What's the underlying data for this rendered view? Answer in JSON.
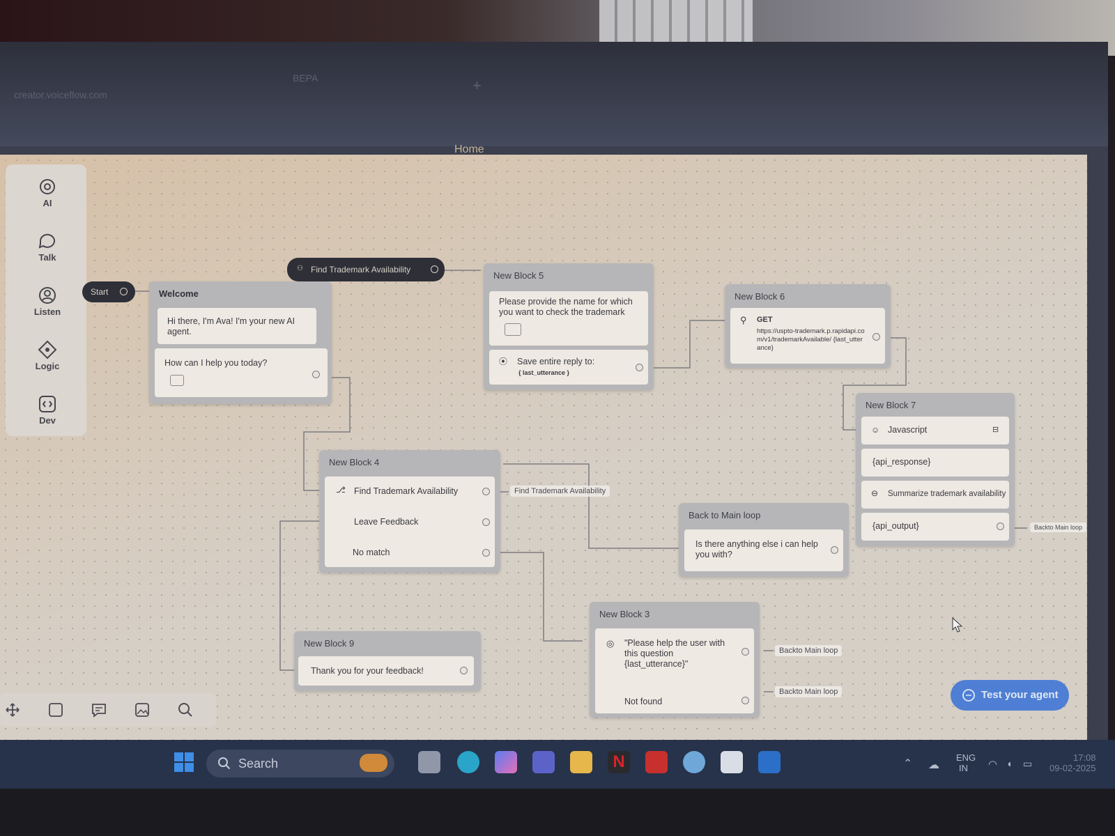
{
  "browser": {
    "url_text": "creator.voiceflow.com",
    "tab_text": "BEPA",
    "new_tab_icon": "plus-icon",
    "page_title": "Home"
  },
  "sidebar": {
    "items": [
      {
        "label": "AI",
        "icon": "openai-icon"
      },
      {
        "label": "Talk",
        "icon": "chat-bubble-icon"
      },
      {
        "label": "Listen",
        "icon": "person-circle-icon"
      },
      {
        "label": "Logic",
        "icon": "diamond-logic-icon"
      },
      {
        "label": "Dev",
        "icon": "code-icon"
      }
    ]
  },
  "start": {
    "label": "Start"
  },
  "trigger": {
    "label": "Find Trademark Availability"
  },
  "welcome": {
    "title": "Welcome",
    "text1": "Hi there, I'm Ava! I'm your new AI agent.",
    "text2": "How can I help you today?"
  },
  "block5": {
    "title": "New Block 5",
    "text": "Please provide the name for which you want to check the trademark",
    "capture_label": "Save entire reply to:",
    "capture_var": "{ last_utterance }"
  },
  "block6": {
    "title": "New Block 6",
    "method": "GET",
    "url": "https://uspto-trademark.p.rapidapi.com/v1/trademarkAvailable/ {last_utterance}"
  },
  "block7": {
    "title": "New Block 7",
    "row1": "Javascript",
    "row2": "{api_response}",
    "row3": "Summarize trademark availability",
    "row4": "{api_output}",
    "tag": "Backto Main loop"
  },
  "block4": {
    "title": "New Block 4",
    "choices": [
      "Find Trademark Availability",
      "Leave Feedback",
      "No match"
    ],
    "tag": "Find Trademark Availability"
  },
  "mainloop": {
    "title": "Back to Main loop",
    "text": "Is there anything else i can help you with?"
  },
  "block3": {
    "title": "New Block 3",
    "prompt": "\"Please help the user with this question {last_utterance}\"",
    "not_found": "Not found",
    "tag1": "Backto Main loop",
    "tag2": "Backto Main loop"
  },
  "block9": {
    "title": "New Block 9",
    "text": "Thank you for your feedback!"
  },
  "toolbar": {
    "icons": [
      "move-icon",
      "note-icon",
      "comment-icon",
      "image-icon",
      "search-icon"
    ]
  },
  "test_button": {
    "label": "Test your agent",
    "icon": "chat-icon"
  },
  "taskbar": {
    "search_label": "Search",
    "lang1": "ENG",
    "lang2": "IN",
    "time": "17:08",
    "date": "09-02-2025"
  },
  "colors": {
    "canvas": "#d6cfc6",
    "node": "#b6b6b8",
    "card": "#efe9e3",
    "accent_button": "#4f7fd4",
    "taskbar": "#27334b"
  }
}
